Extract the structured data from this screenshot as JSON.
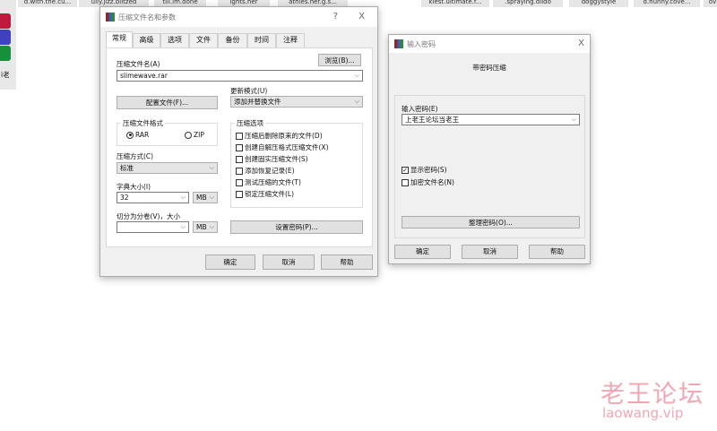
{
  "taskbar_thumbs": [
    "d.with.the.cu...",
    "ully.jizz.blitzed",
    "till.im.done",
    "ights.her",
    "athles.her.g.s...",
    "kiest.ultimate.f...",
    ".spraying.dildo",
    "doggystyle",
    "d.hunny.cove...",
    "ov"
  ],
  "left_strip": {
    "text": "i老"
  },
  "archive_dialog": {
    "title": "压缩文件名和参数",
    "help": "?",
    "close": "X",
    "tabs": [
      "常规",
      "高级",
      "选项",
      "文件",
      "备份",
      "时间",
      "注释"
    ],
    "archive_name_label": "压缩文件名(A)",
    "browse": "浏览(B)...",
    "archive_name": "slimewave.rar",
    "profiles": "配置文件(F)...",
    "update_mode_label": "更新模式(U)",
    "update_mode": "添加并替换文件",
    "format_label": "压缩文件格式",
    "format_rar": "RAR",
    "format_zip": "ZIP",
    "format_selected": "RAR",
    "options_label": "压缩选项",
    "options": [
      {
        "label": "压缩后删除原来的文件(D)",
        "checked": false
      },
      {
        "label": "创建自解压格式压缩文件(X)",
        "checked": false
      },
      {
        "label": "创建固实压缩文件(S)",
        "checked": false
      },
      {
        "label": "添加恢复记录(E)",
        "checked": false
      },
      {
        "label": "测试压缩的文件(T)",
        "checked": false
      },
      {
        "label": "锁定压缩文件(L)",
        "checked": false
      }
    ],
    "method_label": "压缩方式(C)",
    "method": "标准",
    "dict_label": "字典大小(I)",
    "dict": "32",
    "dict_unit": "MB",
    "split_label": "切分为分卷(V)，大小",
    "split": "",
    "split_unit": "MB",
    "set_password": "设置密码(P)...",
    "ok": "确定",
    "cancel": "取消",
    "helpbtn": "帮助"
  },
  "password_dialog": {
    "title": "输入密码",
    "close": "X",
    "heading": "带密码压缩",
    "password_label": "输入密码(E)",
    "password": "上老王论坛当老王",
    "show_password": "显示密码(S)",
    "show_password_checked": true,
    "encrypt_names": "加密文件名(N)",
    "encrypt_names_checked": false,
    "organize": "整理密码(O)...",
    "ok": "确定",
    "cancel": "取消",
    "helpbtn": "帮助"
  },
  "watermark": {
    "line1": "老王论坛",
    "line2": "laowang.vip"
  }
}
